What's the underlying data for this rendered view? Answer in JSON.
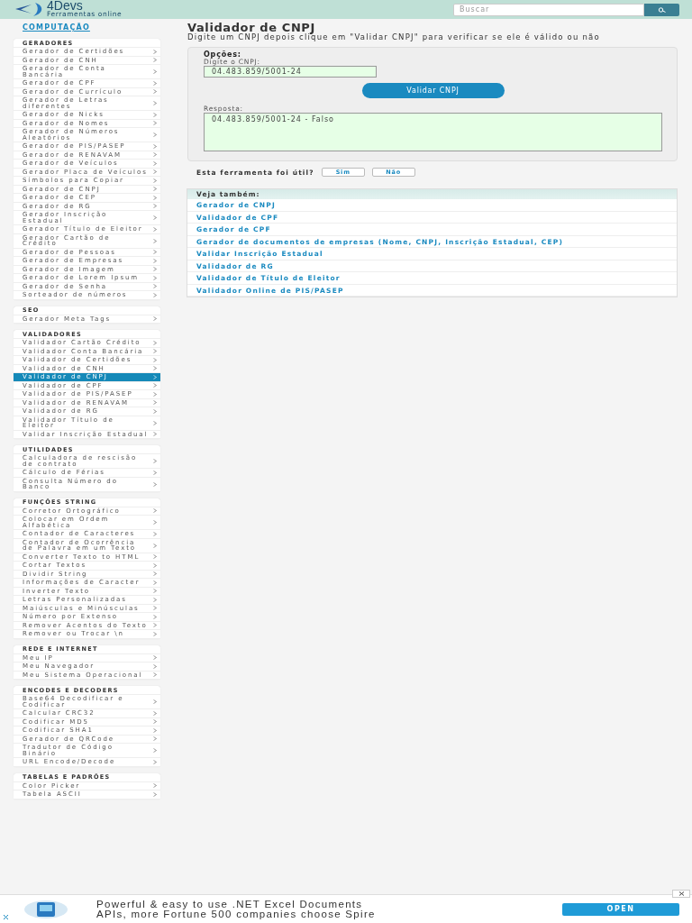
{
  "header": {
    "logo_title": "4Devs",
    "logo_subtitle": "Ferramentas online",
    "search": {
      "placeholder": "Buscar"
    }
  },
  "sidebar": {
    "category": "COMPUTAÇÃO",
    "groups": [
      {
        "title": "GERADORES",
        "items": [
          {
            "label": "Gerador de Certidões",
            "selected": false
          },
          {
            "label": "Gerador de CNH",
            "selected": false
          },
          {
            "label": "Gerador de Conta Bancária",
            "selected": false
          },
          {
            "label": "Gerador de CPF",
            "selected": false
          },
          {
            "label": "Gerador de Currículo",
            "selected": false
          },
          {
            "label": "Gerador de Letras diferentes",
            "selected": false
          },
          {
            "label": "Gerador de Nicks",
            "selected": false
          },
          {
            "label": "Gerador de Nomes",
            "selected": false
          },
          {
            "label": "Gerador de Números Aleatórios",
            "selected": false
          },
          {
            "label": "Gerador de PIS/PASEP",
            "selected": false
          },
          {
            "label": "Gerador de RENAVAM",
            "selected": false
          },
          {
            "label": "Gerador de Veículos",
            "selected": false
          },
          {
            "label": "Gerador Placa de Veículos",
            "selected": false
          },
          {
            "label": "Símbolos para Copiar",
            "selected": false
          },
          {
            "label": "Gerador de CNPJ",
            "selected": false
          },
          {
            "label": "Gerador de CEP",
            "selected": false
          },
          {
            "label": "Gerador de RG",
            "selected": false
          },
          {
            "label": "Gerador Inscrição Estadual",
            "selected": false
          },
          {
            "label": "Gerador Título de Eleitor",
            "selected": false
          },
          {
            "label": "Gerador Cartão de Crédito",
            "selected": false
          },
          {
            "label": "Gerador de Pessoas",
            "selected": false
          },
          {
            "label": "Gerador de Empresas",
            "selected": false
          },
          {
            "label": "Gerador de Imagem",
            "selected": false
          },
          {
            "label": "Gerador de Lorem Ipsum",
            "selected": false
          },
          {
            "label": "Gerador de Senha",
            "selected": false
          },
          {
            "label": "Sorteador de números",
            "selected": false
          }
        ]
      },
      {
        "title": "SEO",
        "items": [
          {
            "label": "Gerador Meta Tags",
            "selected": false
          }
        ]
      },
      {
        "title": "VALIDADORES",
        "items": [
          {
            "label": "Validador Cartão Crédito",
            "selected": false
          },
          {
            "label": "Validador Conta Bancária",
            "selected": false
          },
          {
            "label": "Validador de Certidões",
            "selected": false
          },
          {
            "label": "Validador de CNH",
            "selected": false
          },
          {
            "label": "Validador de CNPJ",
            "selected": true
          },
          {
            "label": "Validador de CPF",
            "selected": false
          },
          {
            "label": "Validador de PIS/PASEP",
            "selected": false
          },
          {
            "label": "Validador de RENAVAM",
            "selected": false
          },
          {
            "label": "Validador de RG",
            "selected": false
          },
          {
            "label": "Validador Título de Eleitor",
            "selected": false
          },
          {
            "label": "Validar Inscrição Estadual",
            "selected": false
          }
        ]
      },
      {
        "title": "UTILIDADES",
        "items": [
          {
            "label": "Calculadora de rescisão de contrato",
            "selected": false
          },
          {
            "label": "Cálculo de Férias",
            "selected": false
          },
          {
            "label": "Consulta Número do Banco",
            "selected": false
          }
        ]
      },
      {
        "title": "FUNÇÕES STRING",
        "items": [
          {
            "label": "Corretor Ortográfico",
            "selected": false
          },
          {
            "label": "Colocar em Ordem Alfabética",
            "selected": false
          },
          {
            "label": "Contador de Caracteres",
            "selected": false
          },
          {
            "label": "Contador de Ocorrência de Palavra em um Texto",
            "selected": false
          },
          {
            "label": "Converter Texto to HTML",
            "selected": false
          },
          {
            "label": "Cortar Textos",
            "selected": false
          },
          {
            "label": "Dividir String",
            "selected": false
          },
          {
            "label": "Informações de Caracter",
            "selected": false
          },
          {
            "label": "Inverter Texto",
            "selected": false
          },
          {
            "label": "Letras Personalizadas",
            "selected": false
          },
          {
            "label": "Maiúsculas e Minúsculas",
            "selected": false
          },
          {
            "label": "Número por Extenso",
            "selected": false
          },
          {
            "label": "Remover Acentos do Texto",
            "selected": false
          },
          {
            "label": "Remover ou Trocar \\n",
            "selected": false
          }
        ]
      },
      {
        "title": "REDE E INTERNET",
        "items": [
          {
            "label": "Meu IP",
            "selected": false
          },
          {
            "label": "Meu Navegador",
            "selected": false
          },
          {
            "label": "Meu Sistema Operacional",
            "selected": false
          }
        ]
      },
      {
        "title": "ENCODES E DECODERS",
        "items": [
          {
            "label": "Base64 Decodificar e Codificar",
            "selected": false
          },
          {
            "label": "Calcular CRC32",
            "selected": false
          },
          {
            "label": "Codificar MD5",
            "selected": false
          },
          {
            "label": "Codificar SHA1",
            "selected": false
          },
          {
            "label": "Gerador de QRCode",
            "selected": false
          },
          {
            "label": "Tradutor de Código Binário",
            "selected": false
          },
          {
            "label": "URL Encode/Decode",
            "selected": false
          }
        ]
      },
      {
        "title": "TABELAS E PADRÕES",
        "items": [
          {
            "label": "Color Picker",
            "selected": false
          },
          {
            "label": "Tabela ASCII",
            "selected": false
          }
        ]
      }
    ]
  },
  "main": {
    "title": "Validador de CNPJ",
    "description": "Digite um CNPJ depois clique em \"Validar CNPJ\" para verificar se ele é válido ou não",
    "options": {
      "heading": "Opções:",
      "input_label": "Digite o CNPJ:",
      "input_value": "04.483.859/5001-24",
      "button": "Validar CNPJ",
      "answer_label": "Resposta:",
      "answer_value": "04.483.859/5001-24 - Falso"
    },
    "feedback": {
      "question": "Esta ferramenta foi útil?",
      "buttons": [
        "Sim",
        "Não"
      ]
    },
    "see_also": {
      "heading": "Veja também:",
      "links": [
        "Gerador de CNPJ",
        "Validador de CPF",
        "Gerador de CPF",
        "Gerador de documentos de empresas (Nome, CNPJ, Inscrição Estadual, CEP)",
        "Validar Inscrição Estadual",
        "Validador de RG",
        "Validador de Título de Eleitor",
        "Validador Online de PIS/PASEP"
      ]
    }
  },
  "ad": {
    "lines": [
      "Powerful & easy to use .NET Excel Documents",
      "APIs, more Fortune 500 companies choose Spire"
    ],
    "button": "OPEN"
  }
}
